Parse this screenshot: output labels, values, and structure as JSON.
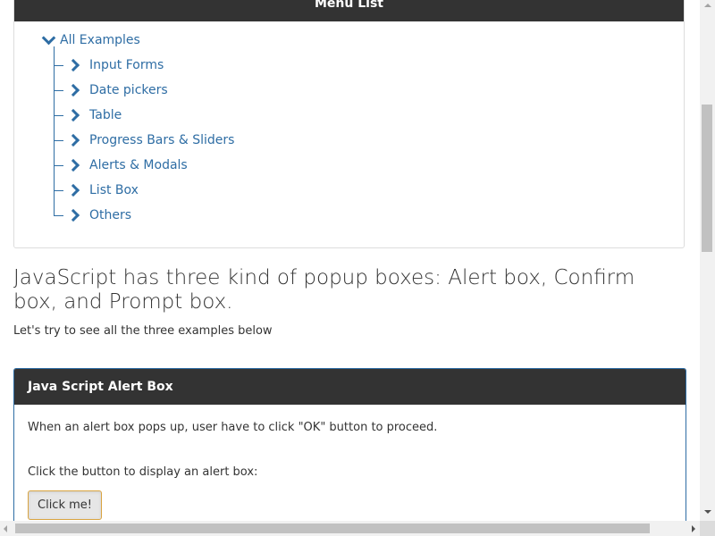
{
  "menu": {
    "header": "Menu List",
    "root_label": "All Examples",
    "items": [
      {
        "label": "Input Forms"
      },
      {
        "label": "Date pickers"
      },
      {
        "label": "Table"
      },
      {
        "label": "Progress Bars & Sliders"
      },
      {
        "label": "Alerts & Modals"
      },
      {
        "label": "List Box"
      },
      {
        "label": "Others"
      }
    ]
  },
  "intro": {
    "heading": "JavaScript has three kind of popup boxes: Alert box, Confirm box, and Prompt box.",
    "subtext": "Let's try to see all the three examples below"
  },
  "alert_box": {
    "title": "Java Script Alert Box",
    "description": "When an alert box pops up, user have to click \"OK\" button to proceed.",
    "instruction": "Click the button to display an alert box:",
    "button_label": "Click me!"
  },
  "colors": {
    "header_bg": "#333333",
    "link": "#2e6da4",
    "button_border": "#d9a441"
  }
}
